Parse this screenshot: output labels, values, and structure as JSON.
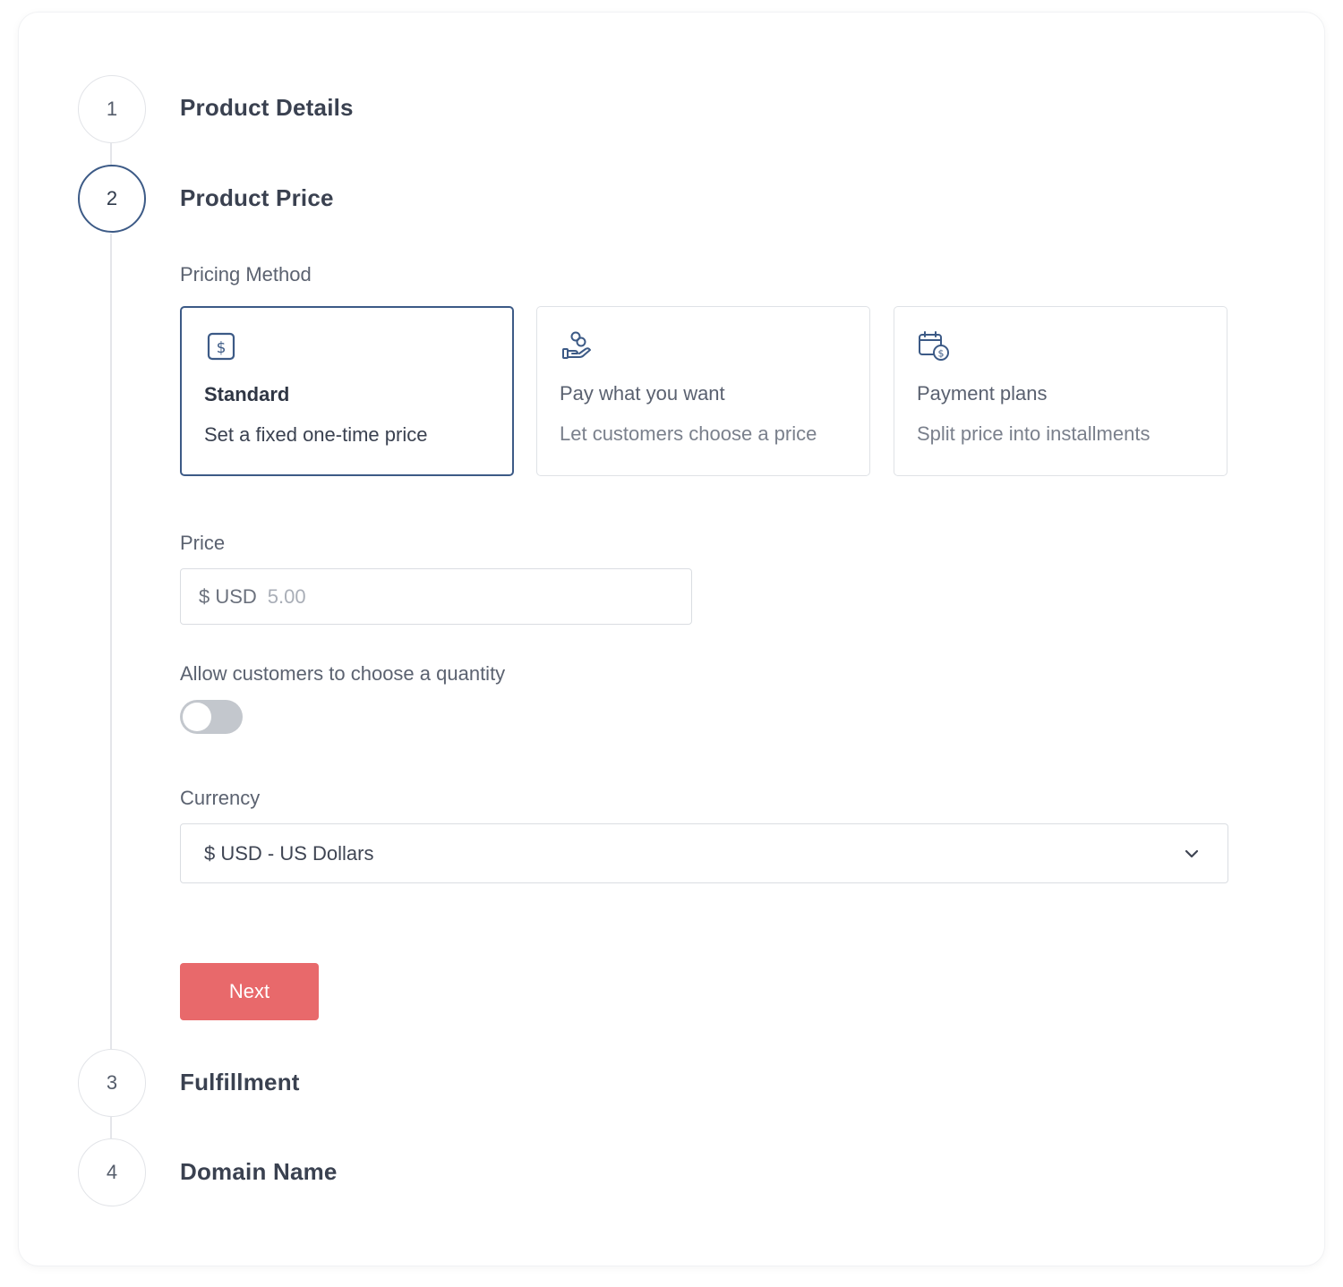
{
  "steps": [
    {
      "number": "1",
      "title": "Product Details",
      "state": "complete"
    },
    {
      "number": "2",
      "title": "Product Price",
      "state": "active"
    },
    {
      "number": "3",
      "title": "Fulfillment",
      "state": "pending"
    },
    {
      "number": "4",
      "title": "Domain Name",
      "state": "pending"
    }
  ],
  "pricing": {
    "section_label": "Pricing Method",
    "selected": "standard",
    "methods": [
      {
        "id": "standard",
        "icon": "dollar-square-icon",
        "title": "Standard",
        "description": "Set a fixed one-time price"
      },
      {
        "id": "pwyw",
        "icon": "hand-coins-icon",
        "title": "Pay what you want",
        "description": "Let customers choose a price"
      },
      {
        "id": "plans",
        "icon": "calendar-dollar-icon",
        "title": "Payment plans",
        "description": "Split price into installments"
      }
    ]
  },
  "price": {
    "label": "Price",
    "prefix": "$ USD",
    "placeholder": "5.00"
  },
  "quantity": {
    "label": "Allow customers to choose a quantity",
    "enabled": false
  },
  "currency": {
    "label": "Currency",
    "selected": "$ USD - US Dollars"
  },
  "actions": {
    "next_label": "Next"
  },
  "colors": {
    "accent": "#3c5a86",
    "button": "#e8696b",
    "toggle_off": "#c3c7cd"
  }
}
